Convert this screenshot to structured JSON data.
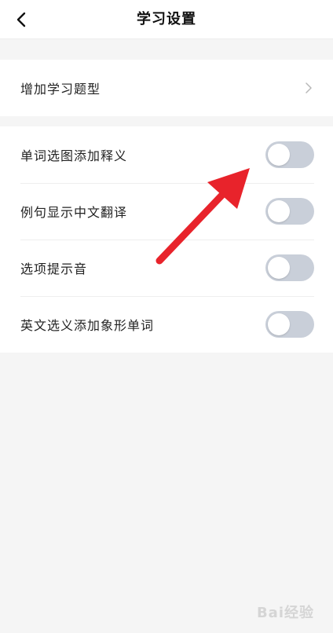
{
  "header": {
    "title": "学习设置",
    "back_icon": "chevron-left-icon"
  },
  "section1": {
    "items": [
      {
        "label": "增加学习题型",
        "icon": "chevron-right-icon"
      }
    ]
  },
  "section2": {
    "items": [
      {
        "label": "单词选图添加释义",
        "toggle": "off"
      },
      {
        "label": "例句显示中文翻译",
        "toggle": "off"
      },
      {
        "label": "选项提示音",
        "toggle": "off"
      },
      {
        "label": "英文选义添加象形单词",
        "toggle": "off"
      }
    ]
  },
  "annotation": {
    "arrow_color": "#e8232b"
  },
  "watermark": {
    "text": "Bai经验"
  },
  "colors": {
    "background": "#f5f5f5",
    "toggle_off": "#c9cfd9",
    "text": "#222222"
  }
}
